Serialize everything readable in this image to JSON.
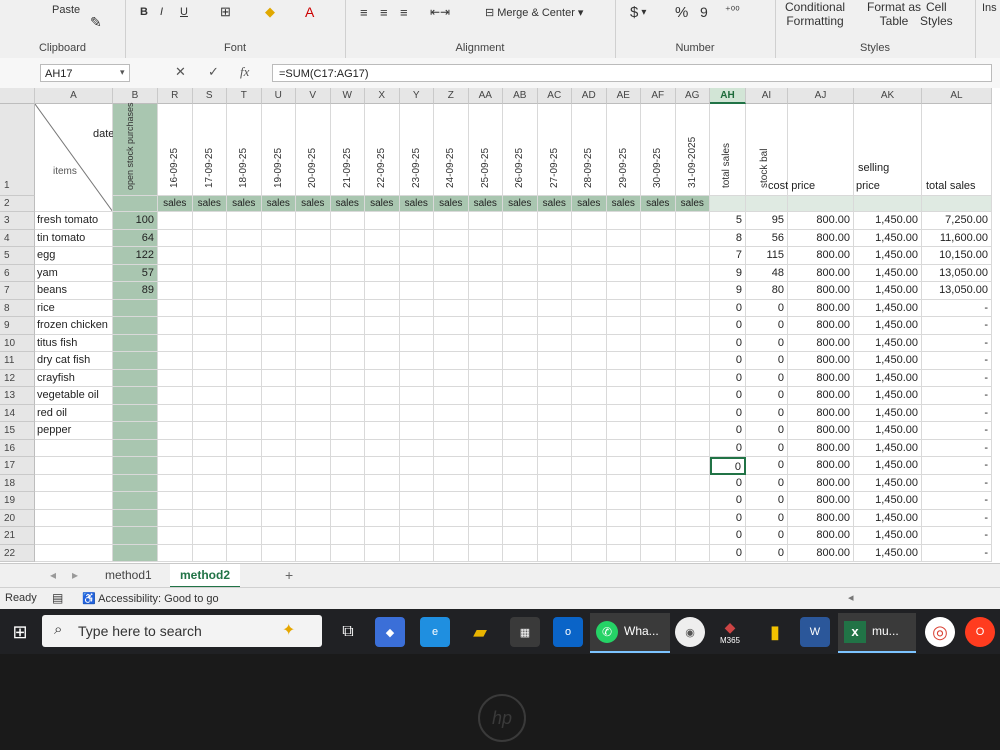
{
  "ribbon": {
    "clipboard": {
      "paste": "Paste",
      "label": "Clipboard"
    },
    "font": {
      "label": "Font",
      "bold": "B",
      "italic": "I",
      "underline": "U",
      "font_color": "A"
    },
    "alignment": {
      "label": "Alignment",
      "merge": "Merge & Center"
    },
    "number": {
      "label": "Number",
      "currency": "$",
      "percent": "%",
      "comma": "9"
    },
    "styles": {
      "label": "Styles",
      "conditional": "Conditional",
      "conditional2": "Formatting",
      "format_as": "Format as",
      "format_as2": "Table",
      "cell": "Cell",
      "cell2": "Styles"
    },
    "insert": "Ins"
  },
  "formula_bar": {
    "name_box": "AH17",
    "cancel": "✕",
    "enter": "✓",
    "fx": "fx",
    "formula": "=SUM(C17:AG17)"
  },
  "columns": {
    "row_hdr": "",
    "A": "A",
    "B": "B",
    "dates": [
      "R",
      "S",
      "T",
      "U",
      "V",
      "W",
      "X",
      "Y",
      "Z",
      "AA",
      "AB",
      "AC",
      "AD",
      "AE",
      "AF",
      "AG"
    ],
    "AH": "AH",
    "AI1": "AI",
    "AJ": "AJ",
    "AK": "AK",
    "AL": "AL"
  },
  "header": {
    "date": "date",
    "items": "items",
    "open_stock": "open stock purchases",
    "dates": [
      "16-09-25",
      "17-09-25",
      "18-09-25",
      "19-09-25",
      "20-09-25",
      "21-09-25",
      "22-09-25",
      "23-09-25",
      "24-09-25",
      "25-09-25",
      "26-09-25",
      "27-09-25",
      "28-09-25",
      "29-09-25",
      "30-09-25",
      "31-09-2025"
    ],
    "total_sales": "total sales",
    "stock_bal": "stock bal",
    "cost_price": "cost price",
    "selling": "selling",
    "price": "price",
    "total_sales2": "total sales",
    "sales": "sales"
  },
  "rows": [
    {
      "n": "3",
      "item": "fresh tomato",
      "open": "100",
      "total": "5",
      "bal": "95",
      "cost": "800.00",
      "sell": "1,450.00",
      "ts": "7,250.00"
    },
    {
      "n": "4",
      "item": "tin tomato",
      "open": "64",
      "total": "8",
      "bal": "56",
      "cost": "800.00",
      "sell": "1,450.00",
      "ts": "11,600.00"
    },
    {
      "n": "5",
      "item": "egg",
      "open": "122",
      "total": "7",
      "bal": "115",
      "cost": "800.00",
      "sell": "1,450.00",
      "ts": "10,150.00"
    },
    {
      "n": "6",
      "item": "yam",
      "open": "57",
      "total": "9",
      "bal": "48",
      "cost": "800.00",
      "sell": "1,450.00",
      "ts": "13,050.00"
    },
    {
      "n": "7",
      "item": "beans",
      "open": "89",
      "total": "9",
      "bal": "80",
      "cost": "800.00",
      "sell": "1,450.00",
      "ts": "13,050.00"
    },
    {
      "n": "8",
      "item": "rice",
      "open": "",
      "total": "0",
      "bal": "0",
      "cost": "800.00",
      "sell": "1,450.00",
      "ts": "-"
    },
    {
      "n": "9",
      "item": "frozen chicken",
      "open": "",
      "total": "0",
      "bal": "0",
      "cost": "800.00",
      "sell": "1,450.00",
      "ts": "-"
    },
    {
      "n": "10",
      "item": "titus fish",
      "open": "",
      "total": "0",
      "bal": "0",
      "cost": "800.00",
      "sell": "1,450.00",
      "ts": "-"
    },
    {
      "n": "11",
      "item": "dry cat fish",
      "open": "",
      "total": "0",
      "bal": "0",
      "cost": "800.00",
      "sell": "1,450.00",
      "ts": "-"
    },
    {
      "n": "12",
      "item": "crayfish",
      "open": "",
      "total": "0",
      "bal": "0",
      "cost": "800.00",
      "sell": "1,450.00",
      "ts": "-"
    },
    {
      "n": "13",
      "item": "vegetable oil",
      "open": "",
      "total": "0",
      "bal": "0",
      "cost": "800.00",
      "sell": "1,450.00",
      "ts": "-"
    },
    {
      "n": "14",
      "item": "red oil",
      "open": "",
      "total": "0",
      "bal": "0",
      "cost": "800.00",
      "sell": "1,450.00",
      "ts": "-"
    },
    {
      "n": "15",
      "item": "pepper",
      "open": "",
      "total": "0",
      "bal": "0",
      "cost": "800.00",
      "sell": "1,450.00",
      "ts": "-"
    },
    {
      "n": "16",
      "item": "",
      "open": "",
      "total": "0",
      "bal": "0",
      "cost": "800.00",
      "sell": "1,450.00",
      "ts": "-"
    },
    {
      "n": "17",
      "item": "",
      "open": "",
      "total": "0",
      "bal": "0",
      "cost": "800.00",
      "sell": "1,450.00",
      "ts": "-"
    },
    {
      "n": "18",
      "item": "",
      "open": "",
      "total": "0",
      "bal": "0",
      "cost": "800.00",
      "sell": "1,450.00",
      "ts": "-"
    },
    {
      "n": "19",
      "item": "",
      "open": "",
      "total": "0",
      "bal": "0",
      "cost": "800.00",
      "sell": "1,450.00",
      "ts": "-"
    },
    {
      "n": "20",
      "item": "",
      "open": "",
      "total": "0",
      "bal": "0",
      "cost": "800.00",
      "sell": "1,450.00",
      "ts": "-"
    },
    {
      "n": "21",
      "item": "",
      "open": "",
      "total": "0",
      "bal": "0",
      "cost": "800.00",
      "sell": "1,450.00",
      "ts": "-"
    },
    {
      "n": "22",
      "item": "",
      "open": "",
      "total": "0",
      "bal": "0",
      "cost": "800.00",
      "sell": "1,450.00",
      "ts": "-"
    }
  ],
  "row1": "1",
  "row2": "2",
  "tabs": {
    "sheet1": "method1",
    "sheet2": "method2",
    "add": "+"
  },
  "status": {
    "ready": "Ready",
    "accessibility": "Accessibility: Good to go"
  },
  "taskbar": {
    "search": "Type here to search",
    "whatsapp": "Wha...",
    "m365": "M365",
    "excel": "mu..."
  },
  "colors": {
    "excel_green": "#217346",
    "header_fill": "#a9c6b0",
    "selected": "#d2e5d6"
  }
}
